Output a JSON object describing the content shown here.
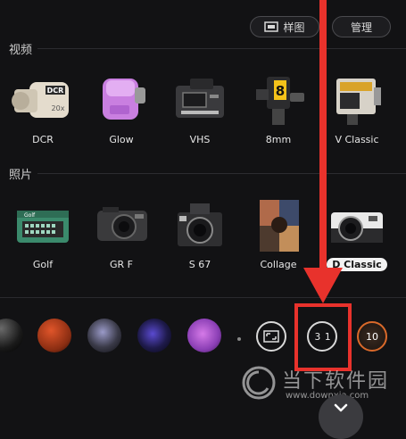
{
  "header": {
    "sample_label": "样图",
    "manage_label": "管理"
  },
  "sections": {
    "video": {
      "title": "视频",
      "items": [
        {
          "label": "DCR"
        },
        {
          "label": "Glow"
        },
        {
          "label": "VHS"
        },
        {
          "label": "8mm"
        },
        {
          "label": "V Classic"
        }
      ]
    },
    "photo": {
      "title": "照片",
      "items": [
        {
          "label": "Golf"
        },
        {
          "label": "GR F"
        },
        {
          "label": "S 67"
        },
        {
          "label": "Collage"
        },
        {
          "label": "D Classic",
          "selected": true
        }
      ]
    }
  },
  "camera_text": {
    "dcr": "DCR",
    "zoom": "20x",
    "eight": "8",
    "golf": "Golf"
  },
  "controls": {
    "date_stamp": "3 1",
    "timer_value": "10"
  },
  "watermark": {
    "main": "当下软件园",
    "sub": "www.downxia.com"
  },
  "colors": {
    "background": "#121214",
    "annotation_red": "#e8322c",
    "timer_orange": "#d9692a"
  }
}
